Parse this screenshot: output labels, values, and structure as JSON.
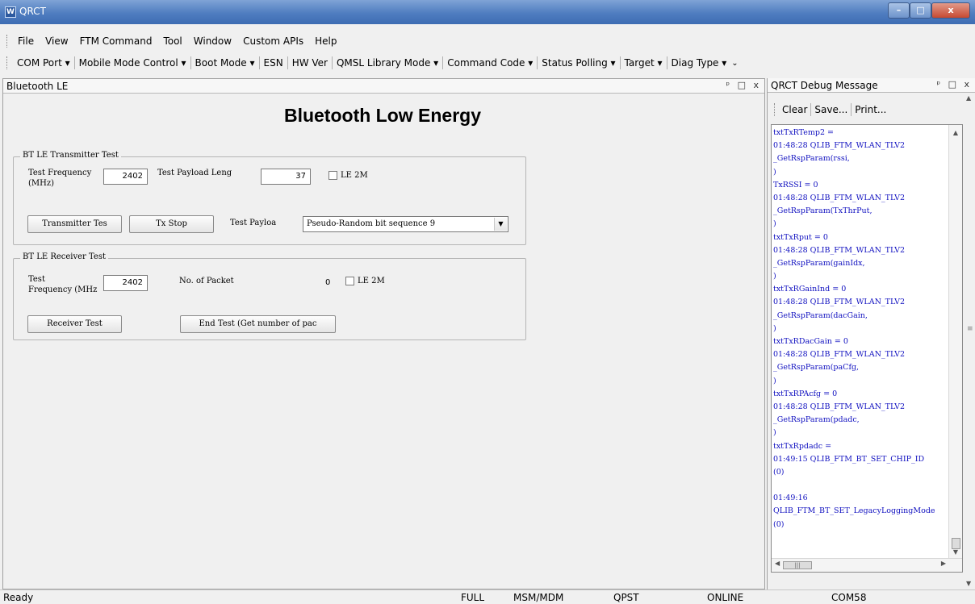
{
  "window": {
    "title": "QRCT",
    "icon": "app-icon",
    "controls": {
      "minimize": "–",
      "maximize": "□",
      "close": "x"
    }
  },
  "menu": {
    "items": [
      {
        "label": "File"
      },
      {
        "label": "View"
      },
      {
        "label": "FTM Command"
      },
      {
        "label": "Tool"
      },
      {
        "label": "Window"
      },
      {
        "label": "Custom APIs"
      },
      {
        "label": "Help"
      }
    ]
  },
  "toolbar": {
    "items": [
      {
        "label": "COM Port ▾"
      },
      {
        "label": "Mobile Mode Control ▾"
      },
      {
        "label": "Boot Mode ▾"
      },
      {
        "label": "ESN"
      },
      {
        "label": "HW Ver"
      },
      {
        "label": "QMSL Library Mode ▾"
      },
      {
        "label": "Command Code ▾"
      },
      {
        "label": "Status Polling ▾"
      },
      {
        "label": "Target ▾"
      },
      {
        "label": "Diag Type ▾"
      }
    ],
    "overflow": "⌄"
  },
  "left_panel": {
    "title": "Bluetooth LE",
    "header_buttons": "ᵖ □ x",
    "heading": "Bluetooth Low Energy",
    "tx_group": {
      "legend": "BT LE Transmitter Test",
      "freq_label_1": "Test Frequency",
      "freq_label_2": "(MHz)",
      "freq_value": "2402",
      "payload_len_label": "Test Payload Leng",
      "payload_len_value": "37",
      "le2m_label": "LE 2M",
      "transmit_button": "Transmitter Tes",
      "stop_button": "Tx Stop",
      "payload_label": "Test Payloa",
      "payload_value": "Pseudo-Random bit sequence 9"
    },
    "rx_group": {
      "legend": "BT LE Receiver Test",
      "freq_label_1": "Test",
      "freq_label_2": "Frequency (MHz",
      "freq_value": "2402",
      "packets_label": "No. of Packet",
      "packets_value": "0",
      "le2m_label": "LE 2M",
      "receive_button": "Receiver Test",
      "end_button": "End Test (Get number of pac"
    }
  },
  "debug_panel": {
    "title": "QRCT Debug Message",
    "header_buttons": "ᵖ □ x",
    "buttons": {
      "clear": "Clear",
      "save": "Save...",
      "print": "Print..."
    },
    "log_lines": [
      "txtTxRTemp2 =",
      "01:48:28  QLIB_FTM_WLAN_TLV2",
      "_GetRspParam(rssi,",
      ")",
      "TxRSSI = 0",
      "01:48:28  QLIB_FTM_WLAN_TLV2",
      "_GetRspParam(TxThrPut,",
      ")",
      "txtTxRput = 0",
      "01:48:28  QLIB_FTM_WLAN_TLV2",
      "_GetRspParam(gainIdx,",
      ")",
      "txtTxRGainInd = 0",
      "01:48:28  QLIB_FTM_WLAN_TLV2",
      "_GetRspParam(dacGain,",
      ")",
      "txtTxRDacGain = 0",
      "01:48:28  QLIB_FTM_WLAN_TLV2",
      "_GetRspParam(paCfg,",
      ")",
      "txtTxRPAcfg = 0",
      "01:48:28  QLIB_FTM_WLAN_TLV2",
      "_GetRspParam(pdadc,",
      ")",
      "txtTxRpdadc =",
      "01:49:15  QLIB_FTM_BT_SET_CHIP_ID",
      "(0)",
      "",
      "01:49:16",
      "QLIB_FTM_BT_SET_LegacyLoggingMode",
      "(0)"
    ]
  },
  "status_bar": {
    "ready": "Ready",
    "full": "FULL",
    "msm": "MSM/MDM",
    "qpst": "QPST",
    "online": "ONLINE",
    "com": "COM58"
  }
}
